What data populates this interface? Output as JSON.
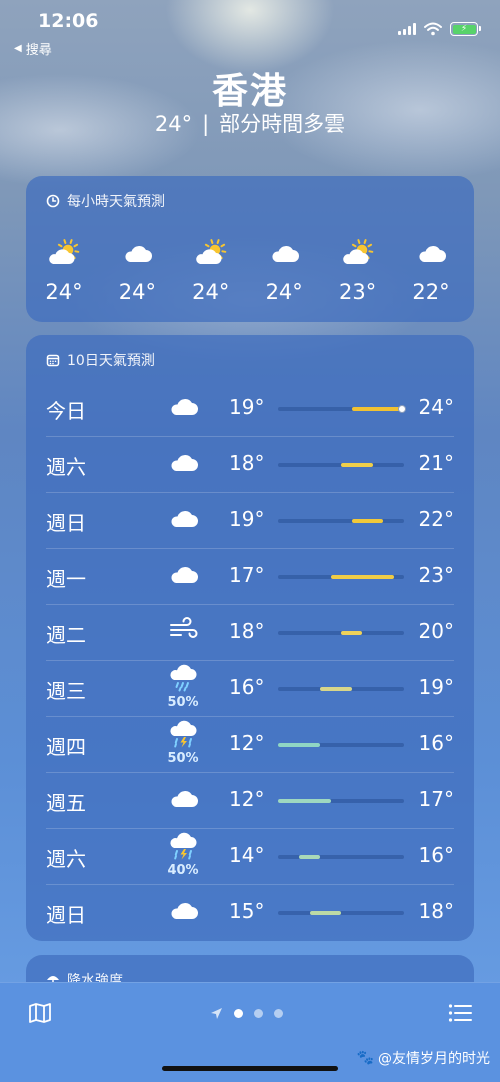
{
  "status": {
    "time": "12:06",
    "back_label": "搜尋"
  },
  "header": {
    "city": "香港",
    "temp": "24°",
    "separator": "|",
    "condition": "部分時間多雲"
  },
  "hourly": {
    "title": "每小時天氣預測",
    "items": [
      {
        "icon": "partly-sunny-icon",
        "temp": "24°"
      },
      {
        "icon": "cloud-icon",
        "temp": "24°"
      },
      {
        "icon": "partly-sunny-icon",
        "temp": "24°"
      },
      {
        "icon": "cloud-icon",
        "temp": "24°"
      },
      {
        "icon": "partly-sunny-icon",
        "temp": "23°"
      },
      {
        "icon": "cloud-icon",
        "temp": "22°"
      }
    ]
  },
  "daily": {
    "title": "10日天氣預測",
    "scale": {
      "min": 12,
      "max": 24
    },
    "days": [
      {
        "day": "今日",
        "icon": "cloud-icon",
        "pct": "",
        "low": "19°",
        "high": "24°",
        "low_v": 19,
        "high_v": 24,
        "now_v": 24,
        "color": "#f1c232"
      },
      {
        "day": "週六",
        "icon": "cloud-icon",
        "pct": "",
        "low": "18°",
        "high": "21°",
        "low_v": 18,
        "high_v": 21,
        "color": "#f0cf4a"
      },
      {
        "day": "週日",
        "icon": "cloud-icon",
        "pct": "",
        "low": "19°",
        "high": "22°",
        "low_v": 19,
        "high_v": 22,
        "color": "#f1c93a"
      },
      {
        "day": "週一",
        "icon": "cloud-icon",
        "pct": "",
        "low": "17°",
        "high": "23°",
        "low_v": 17,
        "high_v": 23,
        "color": "#f0cc45"
      },
      {
        "day": "週二",
        "icon": "wind-icon",
        "pct": "",
        "low": "18°",
        "high": "20°",
        "low_v": 18,
        "high_v": 20,
        "color": "#efd25a"
      },
      {
        "day": "週三",
        "icon": "rain-cloud-icon",
        "pct": "50%",
        "low": "16°",
        "high": "19°",
        "low_v": 16,
        "high_v": 19,
        "color": "#d8d68a"
      },
      {
        "day": "週四",
        "icon": "thunderstorm-icon",
        "pct": "50%",
        "low": "12°",
        "high": "16°",
        "low_v": 12,
        "high_v": 16,
        "color": "#8fd6c4"
      },
      {
        "day": "週五",
        "icon": "cloud-icon",
        "pct": "",
        "low": "12°",
        "high": "17°",
        "low_v": 12,
        "high_v": 17,
        "color": "#9ed8c0"
      },
      {
        "day": "週六",
        "icon": "thunderstorm-icon",
        "pct": "40%",
        "low": "14°",
        "high": "16°",
        "low_v": 14,
        "high_v": 16,
        "color": "#a9d9b8"
      },
      {
        "day": "週日",
        "icon": "cloud-icon",
        "pct": "",
        "low": "15°",
        "high": "18°",
        "low_v": 15,
        "high_v": 18,
        "color": "#bcdaa6"
      }
    ]
  },
  "precip": {
    "title": "降水強度"
  },
  "watermark": "@友情岁月的时光"
}
